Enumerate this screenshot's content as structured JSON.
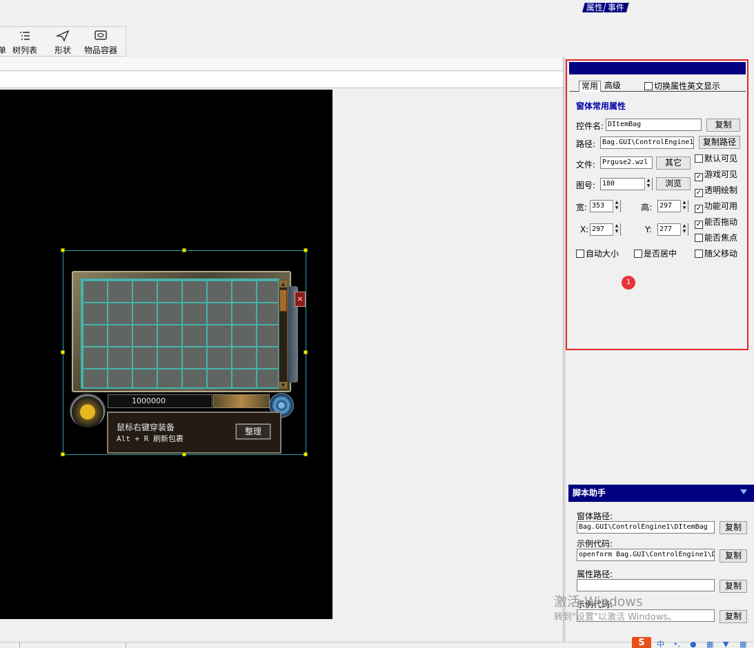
{
  "toolbar": {
    "items": [
      {
        "label": "单",
        "icon": "menu-icon"
      },
      {
        "label": "树列表",
        "icon": "tree-list-icon"
      },
      {
        "label": "形状",
        "icon": "send-arrow-icon"
      },
      {
        "label": "物品容器",
        "icon": "container-icon"
      }
    ]
  },
  "bag": {
    "gold_amount": "1000000",
    "hint_line1": "鼠标右键穿装备",
    "hint_line2": "Alt + R 刷新包裹",
    "sort_button": "整理",
    "close_label": "×",
    "grid_columns": 8,
    "grid_rows": 5
  },
  "properties": {
    "tabs": [
      "属性",
      "事件"
    ],
    "subtabs": [
      "常用",
      "高级"
    ],
    "english_toggle": {
      "label": "切换属性英文显示",
      "checked": false
    },
    "section_title": "窗体常用属性",
    "name_label": "控件名:",
    "name_value": "DItemBag",
    "copy_button": "复制",
    "path_label": "路径:",
    "path_value": "Bag.GUI\\ControlEngine1",
    "copy_path_button": "复制路径",
    "file_label": "文件:",
    "file_value": "Prguse2.wzl",
    "other_button": "其它",
    "image_label": "图号:",
    "image_value": "180",
    "browse_button": "浏览",
    "width_label": "宽:",
    "width_value": "353",
    "height_label": "高:",
    "height_value": "297",
    "x_label": "X:",
    "x_value": "297",
    "y_label": "Y:",
    "y_value": "277",
    "checkboxes": [
      {
        "label": "默认可见",
        "checked": false
      },
      {
        "label": "游戏可见",
        "checked": true
      },
      {
        "label": "透明绘制",
        "checked": true
      },
      {
        "label": "功能可用",
        "checked": true
      },
      {
        "label": "能否拖动",
        "checked": true
      },
      {
        "label": "能否焦点",
        "checked": false
      }
    ],
    "bottom_checkboxes": [
      {
        "label": "自动大小",
        "checked": false
      },
      {
        "label": "是否居中",
        "checked": false
      },
      {
        "label": "随父移动",
        "checked": false
      }
    ],
    "badge": "1"
  },
  "script": {
    "title": "脚本助手",
    "window_path_label": "窗体路径:",
    "window_path_value": "Bag.GUI\\ControlEngine1\\DItemBag",
    "sample_code_label": "示例代码:",
    "sample_code_value": "openform Bag.GUI\\ControlEngine1\\D",
    "attr_path_label": "属性路径:",
    "attr_path_value": "",
    "sample_code2_label": "示例代码:",
    "copy_button": "复制"
  },
  "watermark": {
    "line1": "激活 Windows",
    "line2": "转到\"设置\"以激活 Windows。"
  },
  "tray": {
    "ime_label": "中"
  },
  "colors": {
    "panel_header": "#000080",
    "highlight_outline": "#e0242a",
    "section_title": "#0000aa",
    "grid_line": "#46b3ac",
    "badge": "#e8343a"
  }
}
